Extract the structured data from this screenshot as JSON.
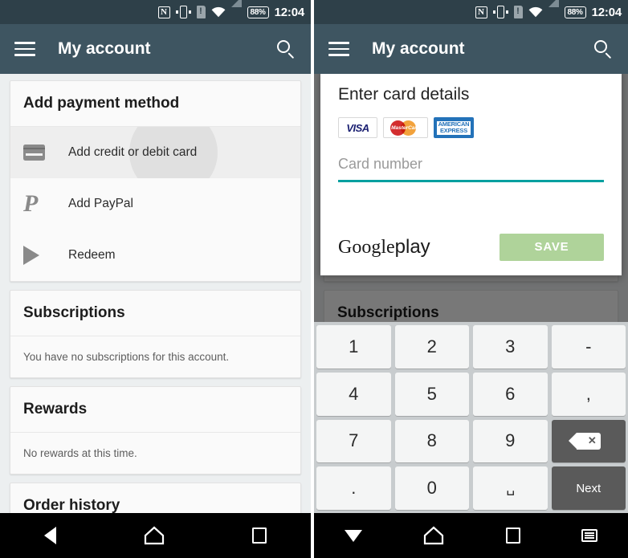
{
  "statusbar": {
    "nfc_label": "N",
    "sim_alert_label": "!",
    "battery_label": "88%",
    "time": "12:04",
    "icons": [
      "nfc-icon",
      "vibrate-icon",
      "sim-alert-icon",
      "wifi-icon",
      "signal-icon",
      "battery-icon"
    ]
  },
  "toolbar": {
    "title": "My account",
    "menu_icon": "hamburger-menu-icon",
    "search_icon": "search-icon"
  },
  "left_screen": {
    "payment_card": {
      "header": "Add payment method",
      "rows": [
        {
          "label": "Add credit or debit card",
          "icon": "credit-card-icon",
          "pressed": true
        },
        {
          "label": "Add PayPal",
          "icon": "paypal-icon",
          "pressed": false
        },
        {
          "label": "Redeem",
          "icon": "play-triangle-icon",
          "pressed": false
        }
      ]
    },
    "subscriptions": {
      "header": "Subscriptions",
      "body": "You have no subscriptions for this account."
    },
    "rewards": {
      "header": "Rewards",
      "body": "No rewards at this time."
    },
    "order_history": {
      "header": "Order history"
    }
  },
  "right_screen": {
    "dialog": {
      "title": "Enter card details",
      "brands": [
        {
          "name": "visa",
          "label": "VISA"
        },
        {
          "name": "mastercard",
          "label": "MasterCard"
        },
        {
          "name": "amex",
          "line1": "AMERICAN",
          "line2": "EXPRESS"
        }
      ],
      "card_number_placeholder": "Card number",
      "card_number_value": "",
      "logo_part1": "Google",
      "logo_part2": "play",
      "save_label": "SAVE",
      "save_enabled": false,
      "underline_color": "#00a0a0",
      "save_color": "#afd39a"
    },
    "keypad": {
      "keys": [
        {
          "label": "1",
          "name": "key-1",
          "style": "light"
        },
        {
          "label": "2",
          "name": "key-2",
          "style": "light"
        },
        {
          "label": "3",
          "name": "key-3",
          "style": "light"
        },
        {
          "label": "-",
          "name": "key-hyphen",
          "style": "light"
        },
        {
          "label": "4",
          "name": "key-4",
          "style": "light"
        },
        {
          "label": "5",
          "name": "key-5",
          "style": "light"
        },
        {
          "label": "6",
          "name": "key-6",
          "style": "light"
        },
        {
          "label": ",",
          "name": "key-comma",
          "style": "light"
        },
        {
          "label": "7",
          "name": "key-7",
          "style": "light"
        },
        {
          "label": "8",
          "name": "key-8",
          "style": "light"
        },
        {
          "label": "9",
          "name": "key-9",
          "style": "light"
        },
        {
          "label": "",
          "name": "key-backspace",
          "style": "backspace"
        },
        {
          "label": ".",
          "name": "key-period",
          "style": "light"
        },
        {
          "label": "0",
          "name": "key-0",
          "style": "light"
        },
        {
          "label": "␣",
          "name": "key-space",
          "style": "space"
        },
        {
          "label": "Next",
          "name": "key-next",
          "style": "dark-small"
        }
      ]
    }
  },
  "navbar_left": {
    "items": [
      {
        "name": "nav-back-button",
        "icon": "back-triangle-icon"
      },
      {
        "name": "nav-home-button",
        "icon": "home-icon"
      },
      {
        "name": "nav-recents-button",
        "icon": "square-recents-icon"
      }
    ]
  },
  "navbar_right": {
    "items": [
      {
        "name": "nav-hide-keyboard-button",
        "icon": "down-triangle-icon"
      },
      {
        "name": "nav-home-button",
        "icon": "home-icon"
      },
      {
        "name": "nav-recents-button",
        "icon": "square-recents-icon"
      },
      {
        "name": "nav-switch-keyboard-button",
        "icon": "keyboard-icon"
      }
    ]
  },
  "colors": {
    "statusbar": "#2e4049",
    "toolbar": "#3e5561",
    "accent_teal": "#00a0a0",
    "save_green": "#afd39a",
    "navbar": "#000000"
  }
}
